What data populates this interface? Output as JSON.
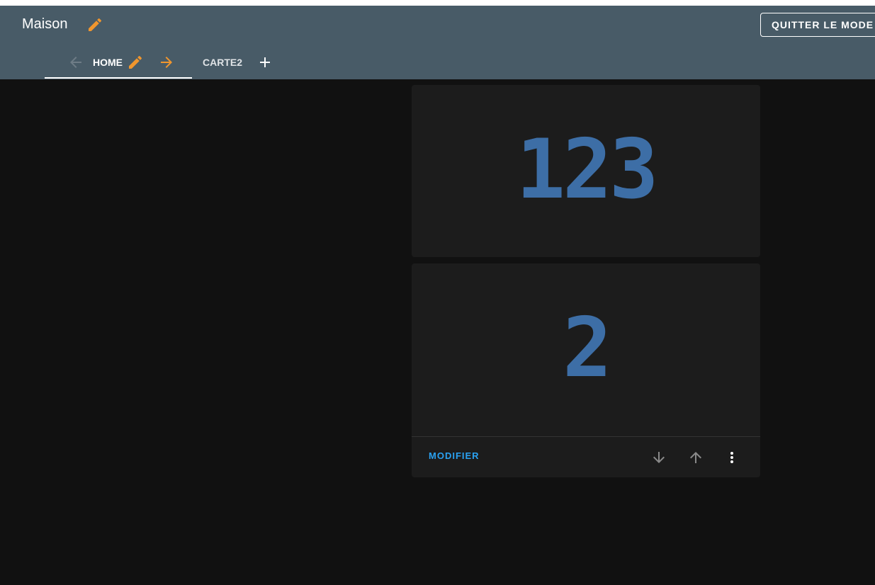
{
  "header": {
    "title": "Maison",
    "exit_label": "QUITTER LE MODE D'ÉDITION"
  },
  "tabs": [
    {
      "label": "HOME",
      "active": true
    },
    {
      "label": "CARTE2",
      "active": false
    }
  ],
  "cards": [
    {
      "value": "123",
      "value_color": "#3d6ea6"
    },
    {
      "value": "2",
      "value_color": "#3d6ea6"
    }
  ],
  "card_actions": {
    "modify_label": "MODIFIER"
  },
  "colors": {
    "header_bg": "#485b67",
    "accent_orange": "#f0962e",
    "page_bg": "#111111",
    "card_bg": "#1c1c1c",
    "link_blue": "#2aa1f0"
  },
  "icons": [
    "pencil-icon",
    "arrow-left-icon",
    "arrow-right-icon",
    "plus-icon",
    "arrow-down-icon",
    "arrow-up-icon",
    "more-vertical-icon"
  ]
}
